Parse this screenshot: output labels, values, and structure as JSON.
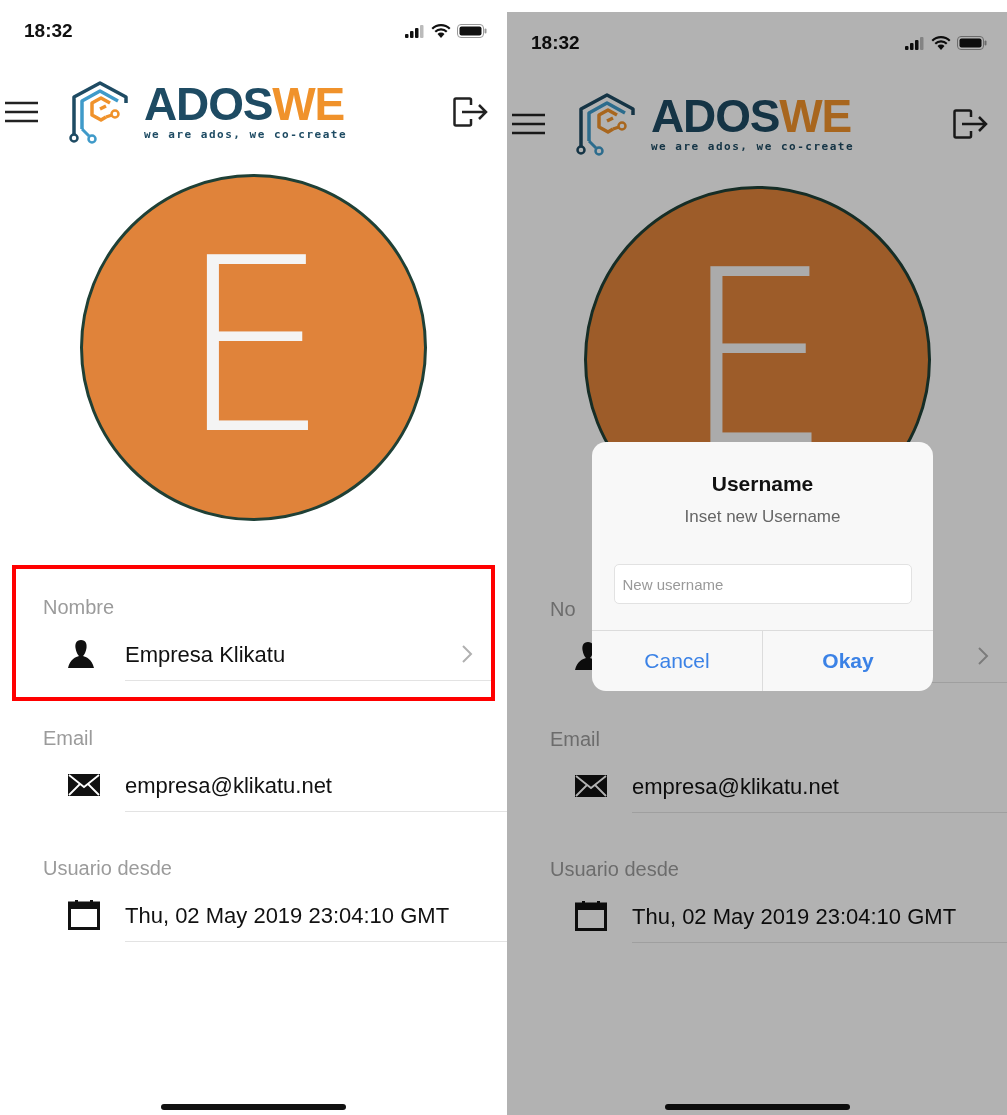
{
  "screens": [
    {
      "dimmed": false,
      "status_bar": {
        "time": "18:32"
      },
      "logo": {
        "name_main": "ADOS",
        "name_accent": "WE",
        "tagline": "we are ados, we co-create"
      },
      "avatar": {
        "initial": "E"
      },
      "fields": [
        {
          "kind": "person",
          "label": "Nombre",
          "value": "Empresa Klikatu",
          "has_chevron": true,
          "highlighted": true
        },
        {
          "kind": "email",
          "label": "Email",
          "value": "empresa@klikatu.net",
          "has_chevron": false,
          "highlighted": false
        },
        {
          "kind": "calendar",
          "label": "Usuario desde",
          "value": "Thu, 02 May 2019 23:04:10 GMT",
          "has_chevron": false,
          "highlighted": false
        }
      ]
    },
    {
      "dimmed": true,
      "status_bar": {
        "time": "18:32"
      },
      "logo": {
        "name_main": "ADOS",
        "name_accent": "WE",
        "tagline": "we are ados, we co-create"
      },
      "avatar": {
        "initial": "E"
      },
      "fields": [
        {
          "kind": "person",
          "label": "No",
          "has_chevron": true,
          "highlighted": false
        },
        {
          "kind": "email",
          "label": "Email",
          "value": "empresa@klikatu.net",
          "has_chevron": false,
          "highlighted": false
        },
        {
          "kind": "calendar",
          "label": "Usuario desde",
          "value": "Thu, 02 May 2019 23:04:10 GMT",
          "has_chevron": false,
          "highlighted": false
        }
      ],
      "dialog": {
        "title": "Username",
        "message": "Inset new Username",
        "input": {
          "placeholder": "New username"
        },
        "buttons": [
          {
            "label": "Cancel",
            "primary": false
          },
          {
            "label": "Okay",
            "primary": true
          }
        ]
      }
    }
  ]
}
